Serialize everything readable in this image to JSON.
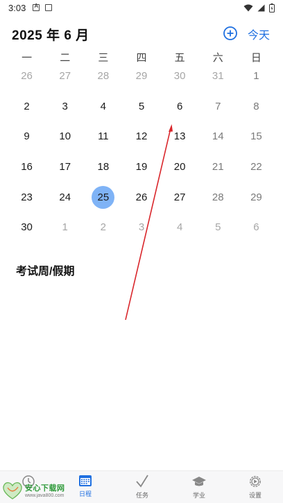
{
  "status_bar": {
    "time": "3:03"
  },
  "header": {
    "month_title": "2025 年 6 月",
    "today_label": "今天"
  },
  "weekdays": [
    "一",
    "二",
    "三",
    "四",
    "五",
    "六",
    "日"
  ],
  "days": [
    {
      "d": "26",
      "t": "other"
    },
    {
      "d": "27",
      "t": "other"
    },
    {
      "d": "28",
      "t": "other"
    },
    {
      "d": "29",
      "t": "other"
    },
    {
      "d": "30",
      "t": "other"
    },
    {
      "d": "31",
      "t": "other"
    },
    {
      "d": "1",
      "t": "weekend"
    },
    {
      "d": "2",
      "t": "cur"
    },
    {
      "d": "3",
      "t": "cur"
    },
    {
      "d": "4",
      "t": "cur"
    },
    {
      "d": "5",
      "t": "cur"
    },
    {
      "d": "6",
      "t": "cur"
    },
    {
      "d": "7",
      "t": "weekend"
    },
    {
      "d": "8",
      "t": "weekend"
    },
    {
      "d": "9",
      "t": "cur"
    },
    {
      "d": "10",
      "t": "cur"
    },
    {
      "d": "11",
      "t": "cur"
    },
    {
      "d": "12",
      "t": "cur"
    },
    {
      "d": "13",
      "t": "cur"
    },
    {
      "d": "14",
      "t": "weekend"
    },
    {
      "d": "15",
      "t": "weekend"
    },
    {
      "d": "16",
      "t": "cur"
    },
    {
      "d": "17",
      "t": "cur"
    },
    {
      "d": "18",
      "t": "cur"
    },
    {
      "d": "19",
      "t": "cur"
    },
    {
      "d": "20",
      "t": "cur"
    },
    {
      "d": "21",
      "t": "weekend"
    },
    {
      "d": "22",
      "t": "weekend"
    },
    {
      "d": "23",
      "t": "cur"
    },
    {
      "d": "24",
      "t": "cur"
    },
    {
      "d": "25",
      "t": "selected"
    },
    {
      "d": "26",
      "t": "cur"
    },
    {
      "d": "27",
      "t": "cur"
    },
    {
      "d": "28",
      "t": "weekend"
    },
    {
      "d": "29",
      "t": "weekend"
    },
    {
      "d": "30",
      "t": "cur"
    },
    {
      "d": "1",
      "t": "other"
    },
    {
      "d": "2",
      "t": "other"
    },
    {
      "d": "3",
      "t": "other"
    },
    {
      "d": "4",
      "t": "other"
    },
    {
      "d": "5",
      "t": "other"
    },
    {
      "d": "6",
      "t": "other"
    }
  ],
  "events": {
    "title": "考试周/假期"
  },
  "nav": [
    {
      "label": "",
      "icon": "clock-icon",
      "active": false
    },
    {
      "label": "日程",
      "icon": "calendar-icon",
      "active": true
    },
    {
      "label": "任务",
      "icon": "check-icon",
      "active": false
    },
    {
      "label": "学业",
      "icon": "graduation-cap-icon",
      "active": false
    },
    {
      "label": "设置",
      "icon": "gear-icon",
      "active": false
    }
  ],
  "watermark": {
    "main": "安心下载网",
    "url": "www.java800.com"
  },
  "colors": {
    "accent": "#1e6fe0",
    "selected_day": "#7fb3f6",
    "annotation_arrow": "#d9252a"
  }
}
